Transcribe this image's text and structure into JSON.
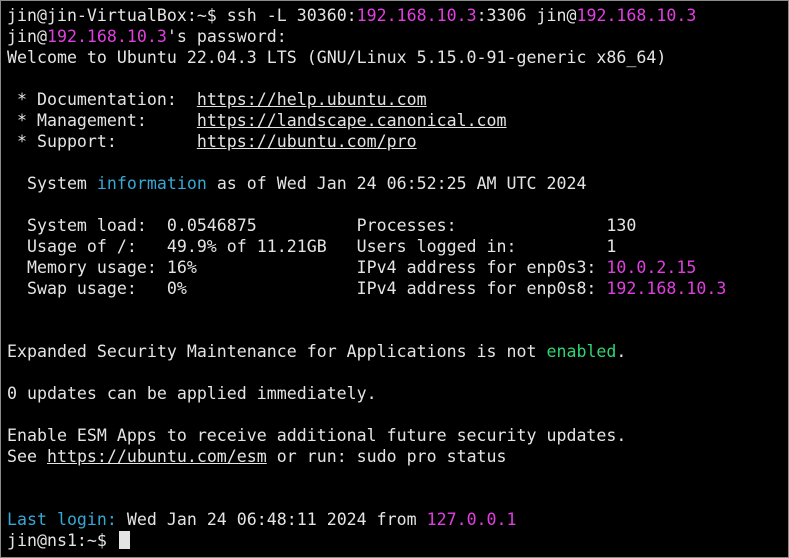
{
  "cmd": {
    "prompt": "jin@jin-VirtualBox:~$ ",
    "ssh": "ssh -L 30360:",
    "ip1": "192.168.10.3",
    "port": ":3306 jin@",
    "ip2": "192.168.10.3"
  },
  "pw": {
    "user": "jin@",
    "ip": "192.168.10.3",
    "suffix": "'s password:"
  },
  "welcome": "Welcome to Ubuntu 22.04.3 LTS (GNU/Linux 5.15.0-91-generic x86_64)",
  "links": [
    {
      "label": " * Documentation:  ",
      "url": "https://help.ubuntu.com"
    },
    {
      "label": " * Management:     ",
      "url": "https://landscape.canonical.com"
    },
    {
      "label": " * Support:        ",
      "url": "https://ubuntu.com/pro"
    }
  ],
  "sysinfo": {
    "pre": "  System ",
    "word": "information",
    "post": " as of Wed Jan 24 06:52:25 AM UTC 2024"
  },
  "stats": [
    {
      "left": "  System load:  0.0546875          Processes:               ",
      "value": "130",
      "colored": false
    },
    {
      "left": "  Usage of /:   49.9% of 11.21GB   Users logged in:         ",
      "value": "1",
      "colored": false
    },
    {
      "left": "  Memory usage: 16%                IPv4 address for enp0s3: ",
      "value": "10.0.2.15",
      "colored": true
    },
    {
      "left": "  Swap usage:   0%                 IPv4 address for enp0s8: ",
      "value": "192.168.10.3",
      "colored": true
    }
  ],
  "esm": {
    "pre": "Expanded Security Maintenance for Applications is not ",
    "word": "enabled",
    "post": "."
  },
  "updates": "0 updates can be applied immediately.",
  "enable": "Enable ESM Apps to receive additional future security updates.",
  "see": {
    "pre": "See ",
    "url": "https://ubuntu.com/esm",
    "post": " or run: sudo pro status"
  },
  "lastlogin": {
    "label": "Last login:",
    "text": " Wed Jan 24 06:48:11 2024 from ",
    "ip": "127.0.0.1"
  },
  "final_prompt": "jin@ns1:~$ ",
  "colors": {
    "magenta": "#e13ee1",
    "cyan": "#35a8d6",
    "green": "#2ed573",
    "text": "#e4e4e4"
  }
}
